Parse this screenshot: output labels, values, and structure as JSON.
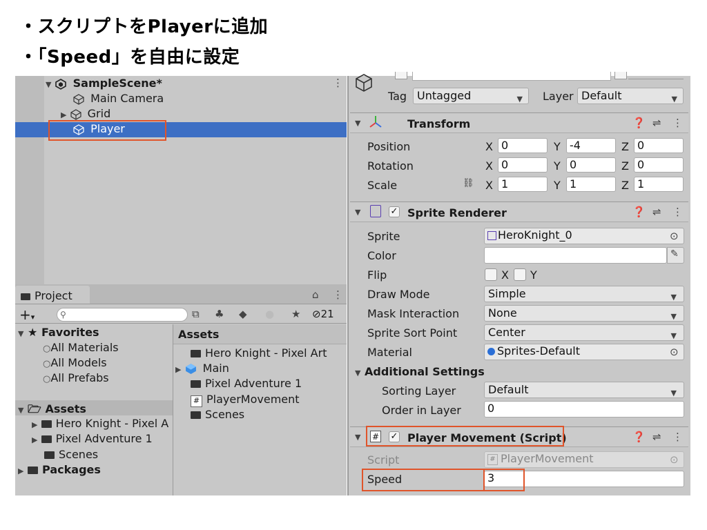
{
  "slide": {
    "bullet_1": "・スクリプトをPlayerに追加",
    "bullet_2": "・「Speed」を自由に設定"
  },
  "hierarchy": {
    "scene": "SampleScene*",
    "items": [
      "Main Camera",
      "Grid",
      "Player"
    ]
  },
  "project": {
    "tab_label": "Project",
    "hidden_count": "21",
    "favorites_label": "Favorites",
    "favorites": [
      "All Materials",
      "All Models",
      "All Prefabs"
    ],
    "assets_label": "Assets",
    "asset_tree": [
      "Hero Knight - Pixel A",
      "Pixel Adventure 1",
      "Scenes"
    ],
    "packages_label": "Packages",
    "assets_header": "Assets",
    "asset_list": [
      "Hero Knight - Pixel Art",
      "Main",
      "Pixel Adventure 1",
      "PlayerMovement",
      "Scenes"
    ]
  },
  "inspector": {
    "tag_label": "Tag",
    "tag_value": "Untagged",
    "layer_label": "Layer",
    "layer_value": "Default",
    "transform": {
      "title": "Transform",
      "rows": [
        {
          "label": "Position",
          "x": "0",
          "y": "-4",
          "z": "0"
        },
        {
          "label": "Rotation",
          "x": "0",
          "y": "0",
          "z": "0"
        },
        {
          "label": "Scale",
          "x": "1",
          "y": "1",
          "z": "1"
        }
      ],
      "axis_x": "X",
      "axis_y": "Y",
      "axis_z": "Z"
    },
    "sprite_renderer": {
      "title": "Sprite Renderer",
      "sprite_label": "Sprite",
      "sprite_value": "HeroKnight_0",
      "color_label": "Color",
      "flip_label": "Flip",
      "flip_x": "X",
      "flip_y": "Y",
      "draw_mode_label": "Draw Mode",
      "draw_mode_value": "Simple",
      "mask_label": "Mask Interaction",
      "mask_value": "None",
      "sort_point_label": "Sprite Sort Point",
      "sort_point_value": "Center",
      "material_label": "Material",
      "material_value": "Sprites-Default",
      "additional_label": "Additional Settings",
      "sorting_layer_label": "Sorting Layer",
      "sorting_layer_value": "Default",
      "order_label": "Order in Layer",
      "order_value": "0"
    },
    "player_movement": {
      "title": "Player Movement (Script)",
      "script_label": "Script",
      "script_value": "PlayerMovement",
      "speed_label": "Speed",
      "speed_value": "3"
    }
  },
  "colors": {
    "selection": "#3d6fc4",
    "highlight": "#e0542a",
    "panel": "#c8c8c8"
  }
}
